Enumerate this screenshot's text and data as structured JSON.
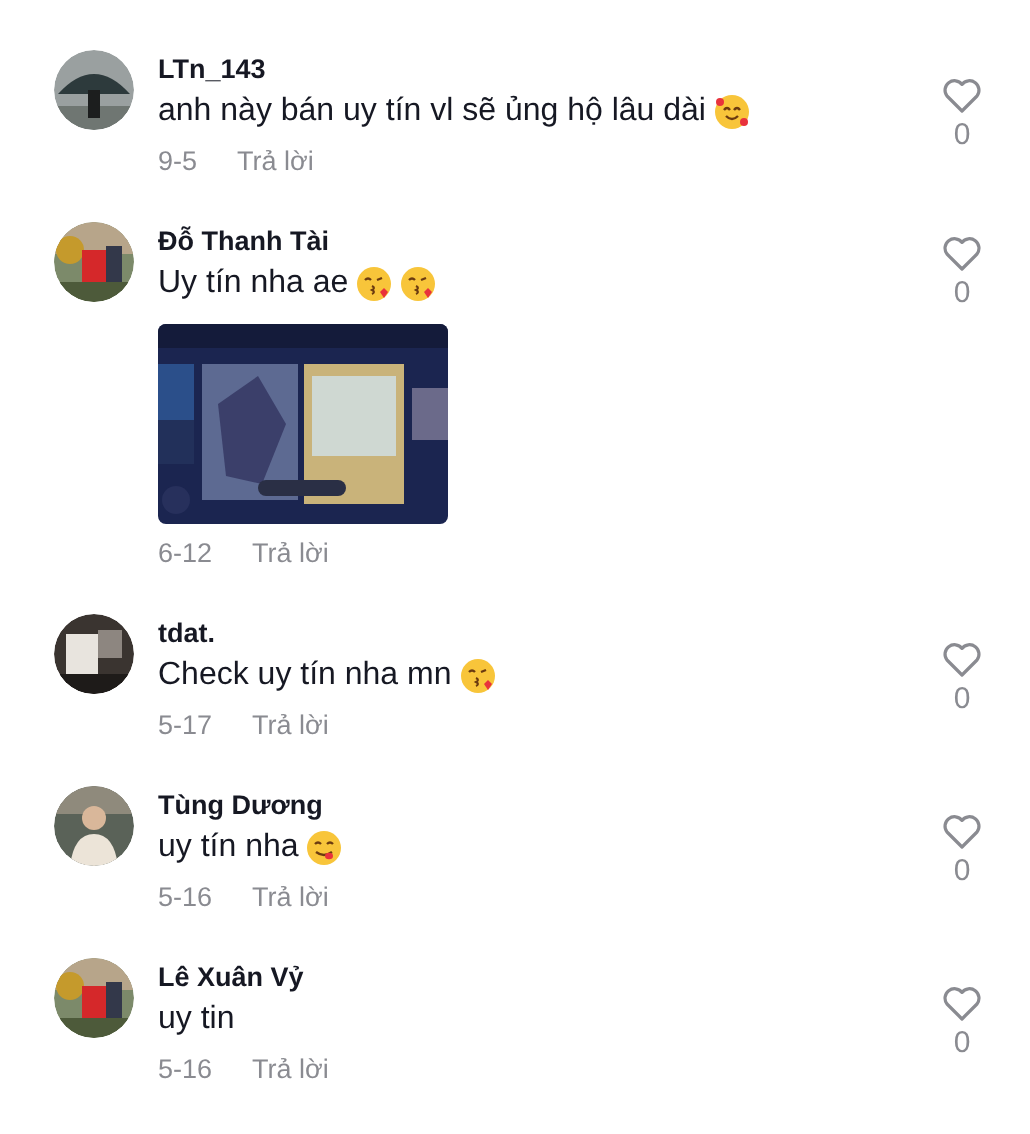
{
  "comments": [
    {
      "author": "LTn_143",
      "text": "anh này bán uy tín vl sẽ ủng hộ lâu dài",
      "emojis": [
        {
          "kind": "hearts"
        }
      ],
      "date": "9-5",
      "reply": "Trả lời",
      "likes": "0"
    },
    {
      "author": "Đỗ Thanh Tài",
      "text": "Uy tín nha ae",
      "emojis": [
        {
          "kind": "kiss"
        },
        {
          "kind": "kiss"
        }
      ],
      "date": "6-12",
      "reply": "Trả lời",
      "likes": "0"
    },
    {
      "author": "tdat.",
      "text": "Check uy tín nha mn",
      "emojis": [
        {
          "kind": "kiss"
        }
      ],
      "date": "5-17",
      "reply": "Trả lời",
      "likes": "0"
    },
    {
      "author": "Tùng Dương",
      "text": "uy tín nha",
      "emojis": [
        {
          "kind": "yum"
        }
      ],
      "date": "5-16",
      "reply": "Trả lời",
      "likes": "0"
    },
    {
      "author": "Lê Xuân Vỷ",
      "text": "uy tin",
      "date": "5-16",
      "reply": "Trả lời",
      "likes": "0"
    }
  ]
}
